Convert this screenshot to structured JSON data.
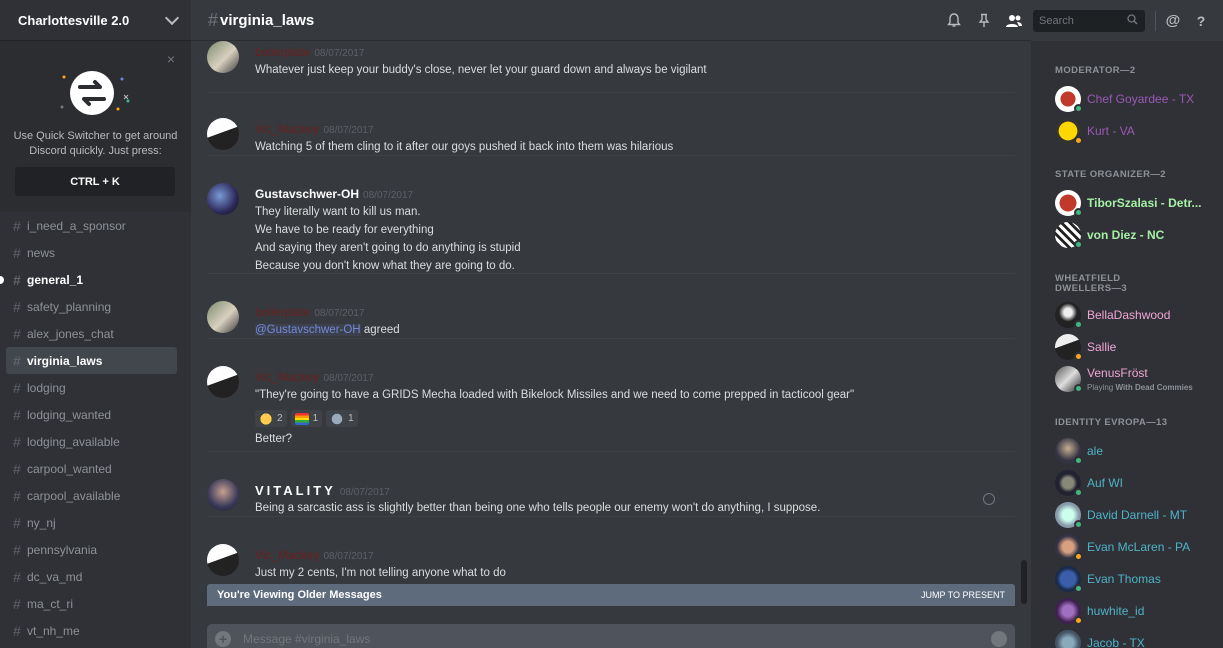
{
  "server": {
    "name": "Charlottesville 2.0"
  },
  "quick_switcher": {
    "text": "Use Quick Switcher to get around Discord quickly. Just press:",
    "shortcut": "CTRL + K",
    "close": "×"
  },
  "channels": [
    {
      "name": "i_need_a_sponsor",
      "state": "normal"
    },
    {
      "name": "news",
      "state": "normal"
    },
    {
      "name": "general_1",
      "state": "unread"
    },
    {
      "name": "safety_planning",
      "state": "normal"
    },
    {
      "name": "alex_jones_chat",
      "state": "normal"
    },
    {
      "name": "virginia_laws",
      "state": "active"
    },
    {
      "name": "lodging",
      "state": "normal"
    },
    {
      "name": "lodging_wanted",
      "state": "normal"
    },
    {
      "name": "lodging_available",
      "state": "normal"
    },
    {
      "name": "carpool_wanted",
      "state": "normal"
    },
    {
      "name": "carpool_available",
      "state": "normal"
    },
    {
      "name": "ny_nj",
      "state": "normal"
    },
    {
      "name": "pennsylvania",
      "state": "normal"
    },
    {
      "name": "dc_va_md",
      "state": "normal"
    },
    {
      "name": "ma_ct_ri",
      "state": "normal"
    },
    {
      "name": "vt_nh_me",
      "state": "normal"
    }
  ],
  "header": {
    "channel": "virginia_laws",
    "search_placeholder": "Search"
  },
  "messages": [
    {
      "author": "boilerplate",
      "author_color": "#6b1f1f",
      "timestamp": "08/07/2017",
      "lines": [
        "Whatever just keep your buddy's close,  never let your guard down and always be vigilant"
      ]
    },
    {
      "author": "Vic_Mackey",
      "author_color": "#6b1f1f",
      "timestamp": "08/07/2017",
      "lines": [
        "Watching 5 of them cling to it after our goys pushed it back into them was hilarious"
      ]
    },
    {
      "author": "Gustavschwer-OH",
      "author_color": "#ffffff",
      "timestamp": "08/07/2017",
      "lines": [
        "They literally want to kill us man.",
        "We have to be ready for everything",
        "And saying they aren't going to do anything is stupid",
        "Because you don't know what they are going to do."
      ]
    },
    {
      "author": "boilerplate",
      "author_color": "#6b1f1f",
      "timestamp": "08/07/2017",
      "mention": "@Gustavschwer-OH",
      "lines": [
        " agreed"
      ]
    },
    {
      "author": "Vic_Mackey",
      "author_color": "#6b1f1f",
      "timestamp": "08/07/2017",
      "lines": [
        "\"They're going to have a GRIDS Mecha loaded with Bikelock Missiles and we need to come prepped in tacticool gear\""
      ],
      "reactions": [
        {
          "emoji": "laughing-emoji",
          "count": "2"
        },
        {
          "emoji": "rainbow-flag-emoji",
          "count": "1"
        },
        {
          "emoji": "robot-emoji",
          "count": "1"
        }
      ],
      "after": "Better?"
    },
    {
      "author": "VITALITY",
      "author_color": "#ffffff",
      "timestamp": "08/07/2017",
      "lines": [
        "Being a sarcastic ass is slightly better than being one who tells people our enemy won't do anything, I suppose."
      ]
    },
    {
      "author": "Vic_Mackey",
      "author_color": "#6b1f1f",
      "timestamp": "08/07/2017",
      "lines": [
        "Just my 2 cents, I'm not telling anyone what to do"
      ]
    }
  ],
  "older_bar": {
    "text": "You're Viewing Older Messages",
    "jump": "JUMP TO PRESENT"
  },
  "composer": {
    "placeholder": "Message #virginia_laws"
  },
  "member_groups": [
    {
      "title": "MODERATOR—2",
      "members": [
        {
          "name": "Chef Goyardee - TX",
          "color": "#9b59b6",
          "status": "online"
        },
        {
          "name": "Kurt - VA",
          "color": "#9b59b6",
          "status": "idle"
        }
      ]
    },
    {
      "title": "STATE ORGANIZER—2",
      "members": [
        {
          "name": "TiborSzalasi - Detr...",
          "color": "#a6f0a6",
          "status": "online"
        },
        {
          "name": "von Diez - NC",
          "color": "#a6f0a6",
          "status": "online"
        }
      ]
    },
    {
      "title": "WHEATFIELD DWELLERS—3",
      "members": [
        {
          "name": "BellaDashwood",
          "color": "#f0a6d6",
          "status": "online"
        },
        {
          "name": "Sallie",
          "color": "#f0a6d6",
          "status": "idle"
        },
        {
          "name": "VenusFröst",
          "color": "#f0a6d6",
          "status": "online",
          "activity_prefix": "Playing ",
          "activity": "With Dead Commies"
        }
      ]
    },
    {
      "title": "IDENTITY EVROPA—13",
      "members": [
        {
          "name": "ale",
          "color": "#4fb3c8",
          "status": "online"
        },
        {
          "name": "Auf WI",
          "color": "#4fb3c8",
          "status": "online"
        },
        {
          "name": "David Darnell - MT",
          "color": "#4fb3c8",
          "status": "online"
        },
        {
          "name": "Evan McLaren - PA",
          "color": "#4fb3c8",
          "status": "idle"
        },
        {
          "name": "Evan Thomas",
          "color": "#4fb3c8",
          "status": "online"
        },
        {
          "name": "huwhite_id",
          "color": "#4fb3c8",
          "status": "idle"
        },
        {
          "name": "Jacob - TX",
          "color": "#4fb3c8",
          "status": "online"
        }
      ]
    }
  ],
  "colors": {
    "online": "#43b581",
    "idle": "#faa61a",
    "accent": "#7289da"
  }
}
